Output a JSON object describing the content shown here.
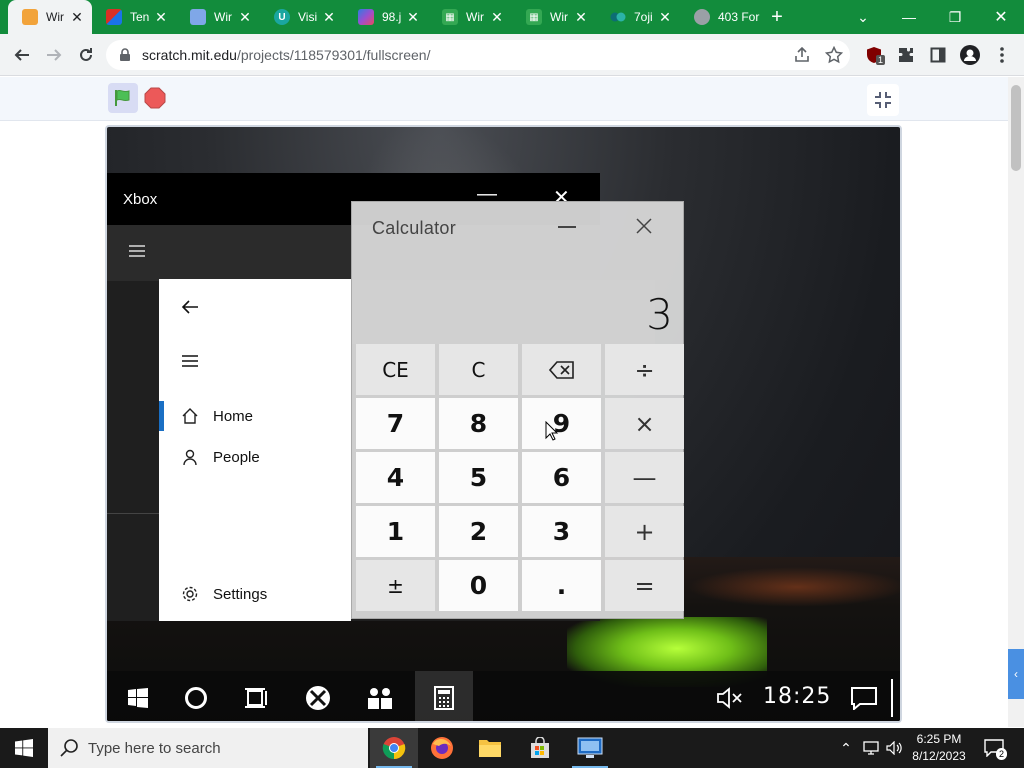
{
  "browser": {
    "tabs": [
      {
        "title": "Wir",
        "icon": "orange-tab-icon",
        "color": "#f2a33a",
        "active": true
      },
      {
        "title": "Ten",
        "icon": "colorful-tab-icon",
        "color": "#d93025",
        "active": false
      },
      {
        "title": "Wir",
        "icon": "blue-tab-icon",
        "color": "#4a7fd4",
        "active": false
      },
      {
        "title": "Visi",
        "icon": "u-tab-icon",
        "color": "#1aa6a0",
        "active": false
      },
      {
        "title": "98.j",
        "icon": "photo-tab-icon",
        "color": "#6a4ea0",
        "active": false
      },
      {
        "title": "Wir",
        "icon": "grid-tab-icon",
        "color": "#1e7f4a",
        "active": false
      },
      {
        "title": "Wir",
        "icon": "grid-tab-icon",
        "color": "#1e7f4a",
        "active": false
      },
      {
        "title": "7oji",
        "icon": "dots-tab-icon",
        "color": "#137a7f",
        "active": false
      },
      {
        "title": "403 For",
        "icon": "globe-tab-icon",
        "color": "#8a8a8a",
        "active": false
      }
    ],
    "url_domain": "scratch.mit.edu",
    "url_path": "/projects/118579301/fullscreen/",
    "extension_badge": "1"
  },
  "xbox": {
    "title": "Xbox",
    "nav": {
      "home": "Home",
      "people": "People",
      "settings": "Settings"
    }
  },
  "calculator": {
    "title": "Calculator",
    "display": "3",
    "keys": {
      "ce": "CE",
      "c": "C",
      "divide": "÷",
      "seven": "7",
      "eight": "8",
      "nine": "9",
      "multiply": "×",
      "four": "4",
      "five": "5",
      "six": "6",
      "minus": "—",
      "one": "1",
      "two": "2",
      "three": "3",
      "plus": "+",
      "plusminus": "±",
      "zero": "0",
      "decimal": ".",
      "equals": "="
    }
  },
  "virtual_taskbar": {
    "clock": "18:25"
  },
  "windows_taskbar": {
    "search_placeholder": "Type here to search",
    "time": "6:25 PM",
    "date": "8/12/2023",
    "notification_count": "2"
  },
  "colors": {
    "tab_strip": "#128c3c",
    "accent": "#4a90e2"
  }
}
